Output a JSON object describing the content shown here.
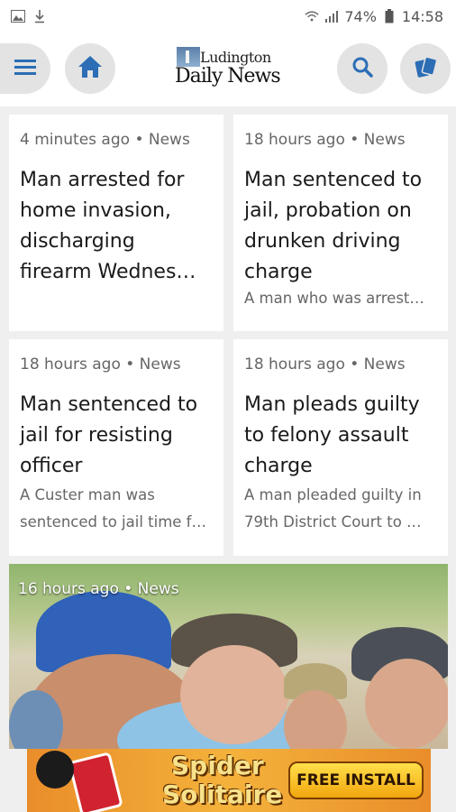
{
  "status_bar": {
    "battery": "74%",
    "time": "14:58",
    "icons": [
      "image-notification-icon",
      "download-icon",
      "wifi-icon",
      "signal-icon",
      "battery-icon"
    ]
  },
  "header": {
    "logo_top": "Ludington",
    "logo_bottom": "Daily News",
    "icons": [
      "menu-icon",
      "home-icon",
      "search-icon",
      "cards-icon"
    ]
  },
  "articles": [
    {
      "meta": "4 minutes ago • News",
      "title": "Man arrested for home invasion, discharging firearm Wednes…",
      "snippet": ""
    },
    {
      "meta": "18 hours ago • News",
      "title": "Man sentenced to jail, probation on drunken driving charge",
      "snippet": "A man who was arrest…"
    },
    {
      "meta": "18 hours ago • News",
      "title": "Man sentenced to jail for resisting officer",
      "snippet": "A Custer man was sentenced to jail time f…"
    },
    {
      "meta": "18 hours ago • News",
      "title": "Man pleads guilty to felony assault charge",
      "snippet": "A man pleaded guilty in 79th District Court to …"
    }
  ],
  "featured": {
    "meta": "16 hours ago • News"
  },
  "ad": {
    "title_line1": "Spider",
    "title_line2": "Solitaire",
    "cta": "FREE INSTALL"
  },
  "colors": {
    "background": "#efefef",
    "card": "#ffffff",
    "icon_blue": "#2c6db5",
    "button_bg": "#e3e3e3"
  }
}
